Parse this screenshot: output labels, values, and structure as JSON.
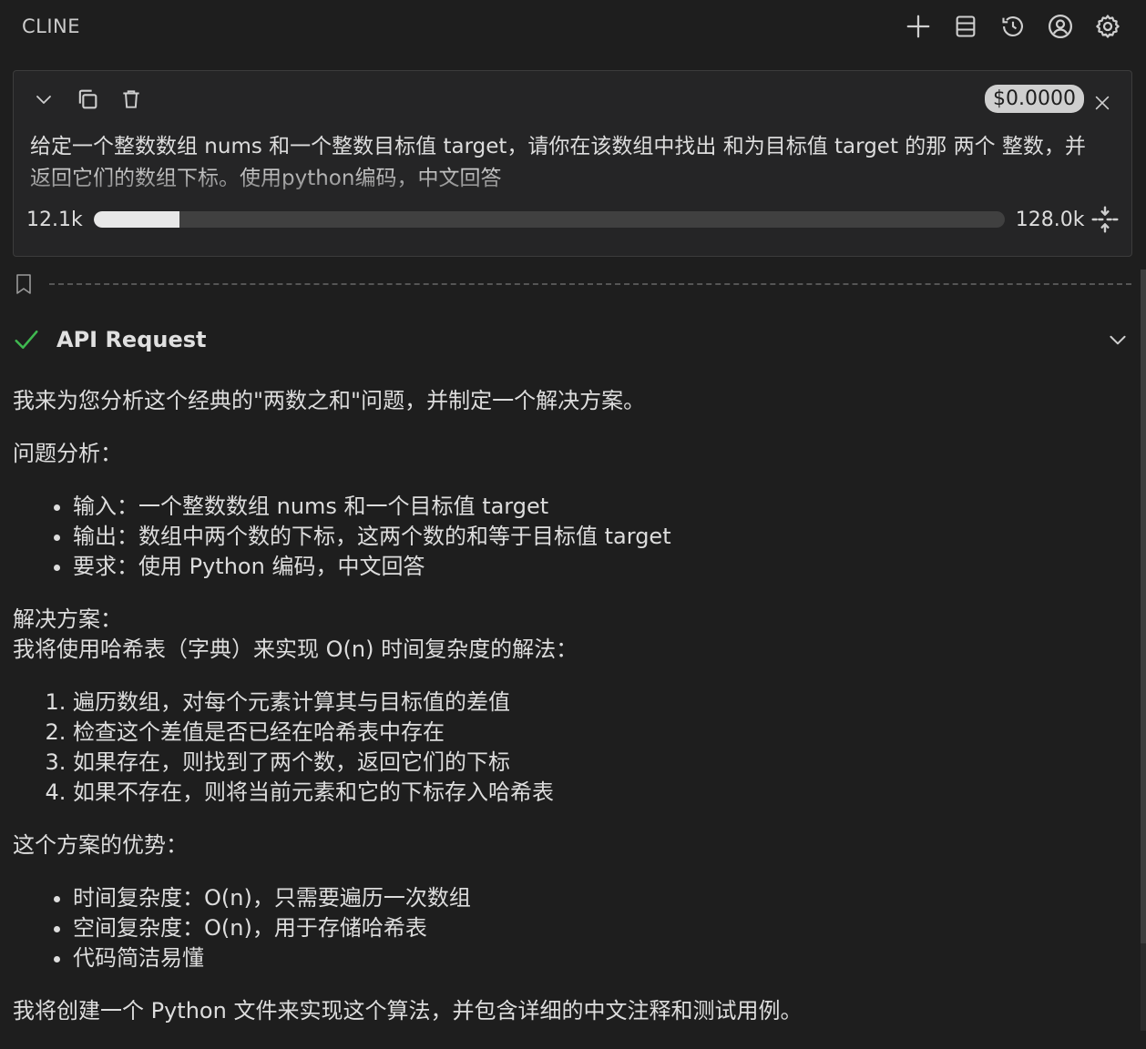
{
  "header": {
    "title": "CLINE",
    "icons": [
      "plus-icon",
      "servers-icon",
      "history-icon",
      "account-icon",
      "gear-icon"
    ]
  },
  "task": {
    "cost": "$0.0000",
    "text": "给定一个整数数组 nums 和一个整数目标值 target，请你在该数组中找出 和为目标值 target  的那 两个 整数，并返回它们的数组下标。使用python编码，中文回答",
    "tokens_used": "12.1k",
    "context_window": "128.0k",
    "context_fraction": 0.094
  },
  "api_request": {
    "label": "API Request",
    "status_color": "#3fb950"
  },
  "message": {
    "intro": "我来为您分析这个经典的\"两数之和\"问题，并制定一个解决方案。",
    "analysis_title": "问题分析：",
    "analysis_items": [
      "输入：一个整数数组 nums 和一个目标值 target",
      "输出：数组中两个数的下标，这两个数的和等于目标值 target",
      "要求：使用 Python 编码，中文回答"
    ],
    "solution_title": "解决方案：",
    "solution_desc": "我将使用哈希表（字典）来实现 O(n) 时间复杂度的解法：",
    "steps": [
      "遍历数组，对每个元素计算其与目标值的差值",
      "检查这个差值是否已经在哈希表中存在",
      "如果存在，则找到了两个数，返回它们的下标",
      "如果不存在，则将当前元素和它的下标存入哈希表"
    ],
    "advantages_title": "这个方案的优势：",
    "advantages": [
      "时间复杂度：O(n)，只需要遍历一次数组",
      "空间复杂度：O(n)，用于存储哈希表",
      "代码简洁易懂"
    ],
    "closing": "我将创建一个 Python 文件来实现这个算法，并包含详细的中文注释和测试用例。"
  }
}
